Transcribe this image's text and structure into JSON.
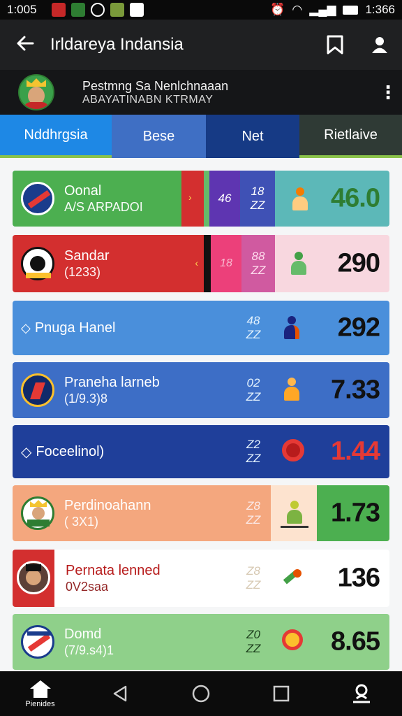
{
  "status": {
    "time_left": "1:005",
    "time_right": "1:366"
  },
  "appbar": {
    "title": "Irldareya Indansia"
  },
  "profile": {
    "line1": "Pestmng Sa Nenlchnaaan",
    "line2": "ABAYATINABN KTRMAY"
  },
  "tabs": [
    "Nddhrgsia",
    "Bese",
    "Net",
    "Rietlaive"
  ],
  "rows": [
    {
      "name": "Oonal",
      "sub": "A/S ARPADOI",
      "stat_a": "",
      "stat_b": "46",
      "stat_c": "18 ZZ",
      "value": "46.0"
    },
    {
      "name": "Sandar",
      "sub": "(1233)",
      "stat_a": "",
      "stat_b": "18",
      "stat_c": "88 ZZ",
      "value": "290"
    },
    {
      "name": "Pnuga Hanel",
      "sub": "",
      "stat_a": "",
      "stat_b": "",
      "stat_c": "48 ZZ",
      "value": "292"
    },
    {
      "name": "Praneha larneb",
      "sub": "(1/9.3)8",
      "stat_a": "",
      "stat_b": "",
      "stat_c": "02 ZZ",
      "value": "7.33"
    },
    {
      "name": "Foceelinol)",
      "sub": "",
      "stat_a": "",
      "stat_b": "",
      "stat_c": "Z2 ZZ",
      "value": "1.44"
    },
    {
      "name": "Perdinoahann",
      "sub": "( 3X1)",
      "stat_a": "",
      "stat_b": "",
      "stat_c": "Z8 ZZ",
      "value": "1.73"
    },
    {
      "name": "Pernata lenned",
      "sub": "0V2saa",
      "stat_a": "",
      "stat_b": "",
      "stat_c": "Z8 ZZ",
      "value": "136"
    },
    {
      "name": "Domd",
      "sub": "(7/9.s4)1",
      "stat_a": "",
      "stat_b": "",
      "stat_c": "Z0 ZZ",
      "value": "8.65"
    }
  ],
  "nav": {
    "home_label": "Pienides"
  },
  "colors": {
    "accent": "#8bc34a",
    "tab_active": "#1e88e5"
  }
}
